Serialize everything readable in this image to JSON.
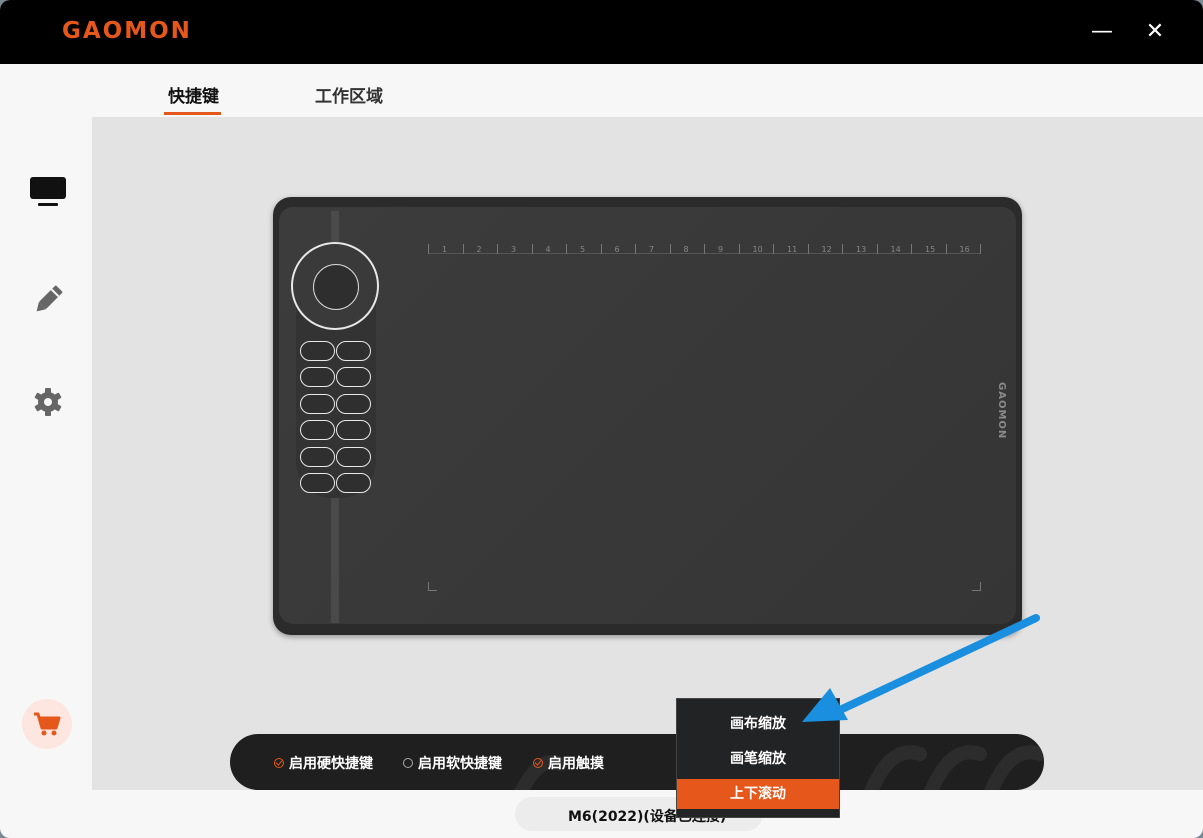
{
  "titlebar": {
    "logo": "GAOMON",
    "minimize_label": "—",
    "close_label": "✕"
  },
  "tabs": [
    {
      "label": "快捷键",
      "active": true
    },
    {
      "label": "工作区域",
      "active": false
    }
  ],
  "sidebar": {
    "items": [
      "monitor-icon",
      "pen-icon",
      "gear-icon"
    ],
    "bottom": "cart-icon"
  },
  "tablet": {
    "brand": "GAOMON",
    "ruler": [
      "1",
      "2",
      "3",
      "4",
      "5",
      "6",
      "7",
      "8",
      "9",
      "10",
      "11",
      "12",
      "13",
      "14",
      "15",
      "16"
    ],
    "express_keys_count": 12
  },
  "options": [
    {
      "label": "启用硬快捷键",
      "checked": true
    },
    {
      "label": "启用软快捷键",
      "checked": false
    },
    {
      "label": "启用触摸",
      "checked": true
    }
  ],
  "status": {
    "device": "M6(2022)(设备已连接)"
  },
  "context_menu": {
    "items": [
      {
        "label": "画布缩放",
        "selected": false
      },
      {
        "label": "画笔缩放",
        "selected": false
      },
      {
        "label": "上下滚动",
        "selected": true
      }
    ]
  },
  "colors": {
    "accent": "#e5571a",
    "titlebar": "#000000",
    "annotation_arrow": "#1a8fe0"
  }
}
